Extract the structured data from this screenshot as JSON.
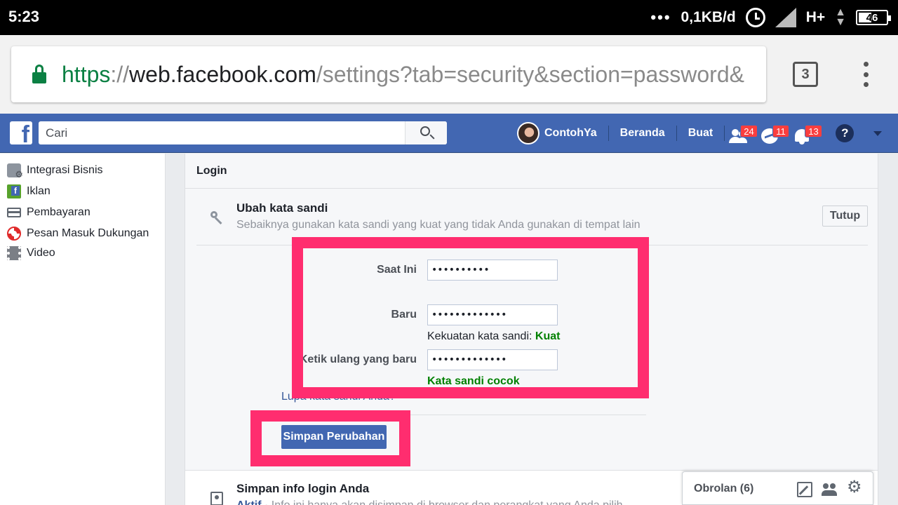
{
  "status_bar": {
    "time": "5:23",
    "dots": "•••",
    "network_speed": "0,1KB/d",
    "network_type": "H+",
    "battery": "46"
  },
  "browser": {
    "url_scheme": "https",
    "url_separator": "://",
    "url_host": "web.facebook.com",
    "url_path": "/settings?tab=security&section=password&",
    "tab_count": "3",
    "secure_color": "#0b8043"
  },
  "fb_header": {
    "logo": "f",
    "search_placeholder": "Cari",
    "profile_name": "ContohYa",
    "home_label": "Beranda",
    "create_label": "Buat",
    "friend_requests_count": "24",
    "messages_count": "11",
    "notifications_count": "13",
    "help_label": "?",
    "brand_color": "#4267b2"
  },
  "sidebar": {
    "items": [
      {
        "label": "Integrasi Bisnis",
        "icon": "business-integrations-icon"
      },
      {
        "label": "Iklan",
        "icon": "ads-icon"
      },
      {
        "label": "Pembayaran",
        "icon": "payment-card-icon"
      },
      {
        "label": "Pesan Masuk Dukungan",
        "icon": "lifebuoy-icon"
      },
      {
        "label": "Video",
        "icon": "film-icon"
      }
    ]
  },
  "main": {
    "section_header": "Login",
    "change_password": {
      "title": "Ubah kata sandi",
      "subtitle": "Sebaiknya gunakan kata sandi yang kuat yang tidak Anda gunakan di tempat lain",
      "close_label": "Tutup",
      "current_label": "Saat Ini",
      "current_value": "••••••••••",
      "new_label": "Baru",
      "new_value": "•••••••••••••",
      "strength_label": "Kekuatan kata sandi:",
      "strength_value": "Kuat",
      "retype_label": "Ketik ulang yang baru",
      "retype_value": "•••••••••••••",
      "match_label": "Kata sandi cocok",
      "forgot_label": "Lupa kata sandi Anda?",
      "save_label": "Simpan Perubahan",
      "success_color": "#008000",
      "highlight_color": "#ff2d6f"
    },
    "save_login_info": {
      "title": "Simpan info login Anda",
      "status": "Aktif",
      "description": " · Info ini hanya akan disimpan di browser dan perangkat yang Anda pilih"
    }
  },
  "chat": {
    "label": "Obrolan (6)"
  }
}
